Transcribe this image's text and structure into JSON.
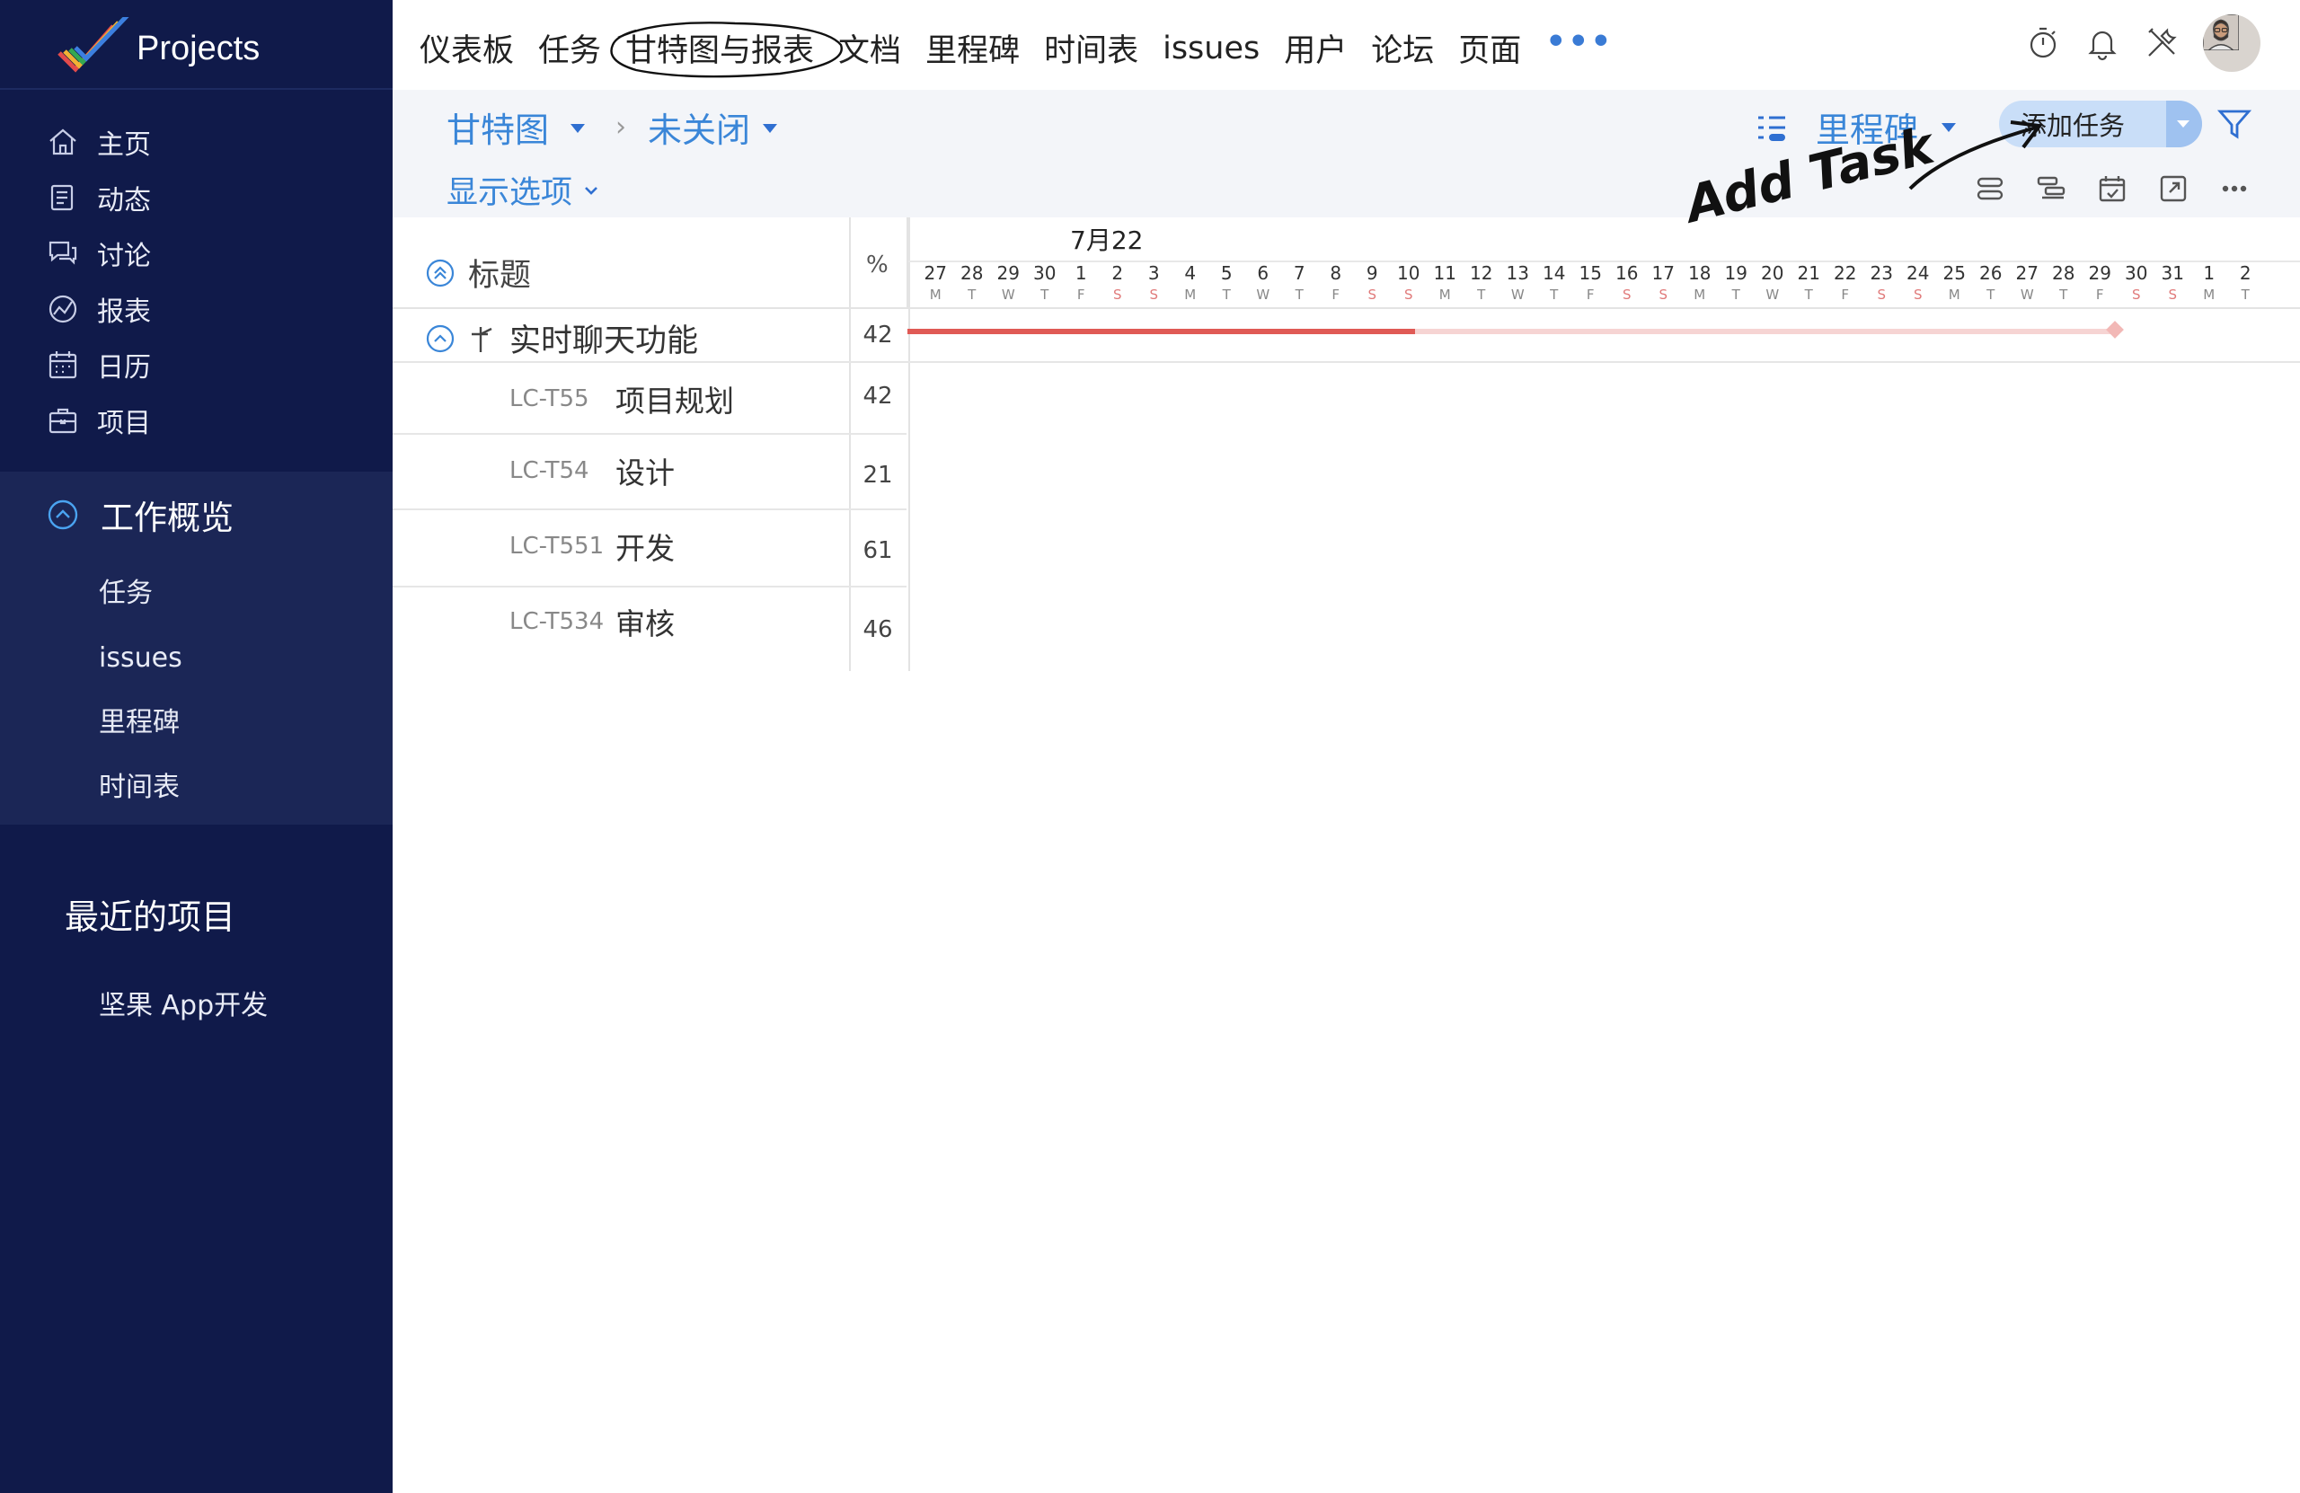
{
  "app": {
    "name": "Projects"
  },
  "sidebar": {
    "items": [
      {
        "label": "主页",
        "icon": "home-icon"
      },
      {
        "label": "动态",
        "icon": "feed-icon"
      },
      {
        "label": "讨论",
        "icon": "discussion-icon"
      },
      {
        "label": "报表",
        "icon": "reports-icon"
      },
      {
        "label": "日历",
        "icon": "calendar-icon"
      },
      {
        "label": "项目",
        "icon": "briefcase-icon"
      }
    ],
    "work_overview": {
      "title": "工作概览",
      "items": [
        "任务",
        "issues",
        "里程碑",
        "时间表"
      ]
    },
    "recent": {
      "title": "最近的项目",
      "items": [
        "坚果 App开发"
      ]
    }
  },
  "topnav": {
    "items": [
      "仪表板",
      "任务",
      "甘特图与报表",
      "文档",
      "里程碑",
      "时间表",
      "issues",
      "用户",
      "论坛",
      "页面"
    ],
    "active_index": 2,
    "more": "•••"
  },
  "toolbar": {
    "view": "甘特图",
    "filter": "未关闭",
    "group_by": "里程碑",
    "add_task": "添加任务",
    "display_options": "显示选项"
  },
  "gantt": {
    "columns": {
      "title": "标题",
      "percent": "%"
    },
    "month": "7月22",
    "days": [
      {
        "d": "27",
        "w": "M"
      },
      {
        "d": "28",
        "w": "T"
      },
      {
        "d": "29",
        "w": "W"
      },
      {
        "d": "30",
        "w": "T"
      },
      {
        "d": "1",
        "w": "F"
      },
      {
        "d": "2",
        "w": "S"
      },
      {
        "d": "3",
        "w": "S"
      },
      {
        "d": "4",
        "w": "M"
      },
      {
        "d": "5",
        "w": "T"
      },
      {
        "d": "6",
        "w": "W"
      },
      {
        "d": "7",
        "w": "T"
      },
      {
        "d": "8",
        "w": "F"
      },
      {
        "d": "9",
        "w": "S"
      },
      {
        "d": "10",
        "w": "S"
      },
      {
        "d": "11",
        "w": "M"
      },
      {
        "d": "12",
        "w": "T"
      },
      {
        "d": "13",
        "w": "W"
      },
      {
        "d": "14",
        "w": "T"
      },
      {
        "d": "15",
        "w": "F"
      },
      {
        "d": "16",
        "w": "S"
      },
      {
        "d": "17",
        "w": "S"
      },
      {
        "d": "18",
        "w": "M"
      },
      {
        "d": "19",
        "w": "T"
      },
      {
        "d": "20",
        "w": "W"
      },
      {
        "d": "21",
        "w": "T"
      },
      {
        "d": "22",
        "w": "F"
      },
      {
        "d": "23",
        "w": "S"
      },
      {
        "d": "24",
        "w": "S"
      },
      {
        "d": "25",
        "w": "M"
      },
      {
        "d": "26",
        "w": "T"
      },
      {
        "d": "27",
        "w": "W"
      },
      {
        "d": "28",
        "w": "T"
      },
      {
        "d": "29",
        "w": "F"
      },
      {
        "d": "30",
        "w": "S"
      },
      {
        "d": "31",
        "w": "S"
      },
      {
        "d": "1",
        "w": "M"
      },
      {
        "d": "2",
        "w": "T"
      }
    ],
    "milestone": {
      "name": "实时聊天功能",
      "percent": "42"
    },
    "tasks": [
      {
        "id": "LC-T55",
        "name": "项目规划",
        "percent": "42"
      },
      {
        "id": "LC-T54",
        "name": "设计",
        "percent": "21"
      },
      {
        "id": "LC-T551",
        "name": "开发",
        "percent": "61"
      },
      {
        "id": "LC-T534",
        "name": "审核",
        "percent": "46"
      }
    ],
    "progress_fraction": 0.42,
    "colors": {
      "bar": "#e05a55",
      "bar_track": "#f6d4d3",
      "accent": "#3a86d8",
      "sidebar": "#101a4a"
    }
  },
  "annotation": {
    "text": "Add Task"
  }
}
